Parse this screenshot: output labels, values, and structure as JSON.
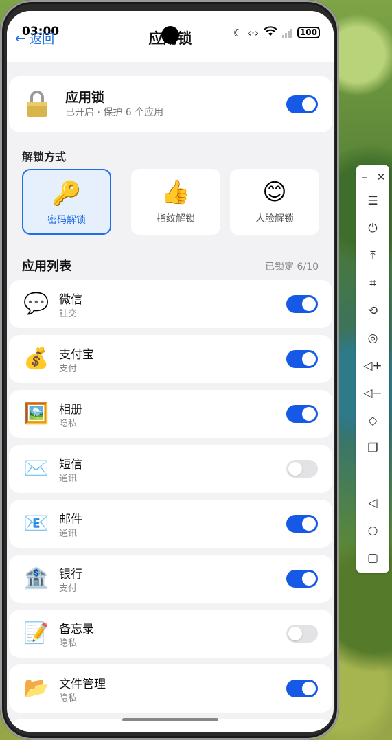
{
  "status_bar": {
    "time": "03:00",
    "battery": "100"
  },
  "nav": {
    "back_label": "返回",
    "title": "应用锁"
  },
  "app_lock": {
    "title": "应用锁",
    "subtitle": "已开启 · 保护 6 个应用",
    "enabled": true
  },
  "unlock_methods": {
    "heading": "解锁方式",
    "options": [
      {
        "emoji": "🔑",
        "label": "密码解锁",
        "selected": true
      },
      {
        "emoji": "👍",
        "label": "指纹解锁",
        "selected": false
      },
      {
        "emoji": "😊",
        "label": "人脸解锁",
        "selected": false
      }
    ]
  },
  "app_list": {
    "heading": "应用列表",
    "locked_count": "已锁定 6/10",
    "items": [
      {
        "emoji": "💬",
        "name": "微信",
        "category": "社交",
        "locked": true
      },
      {
        "emoji": "💰",
        "name": "支付宝",
        "category": "支付",
        "locked": true
      },
      {
        "emoji": "🖼️",
        "name": "相册",
        "category": "隐私",
        "locked": true
      },
      {
        "emoji": "✉️",
        "name": "短信",
        "category": "通讯",
        "locked": false
      },
      {
        "emoji": "📧",
        "name": "邮件",
        "category": "通讯",
        "locked": true
      },
      {
        "emoji": "🏦",
        "name": "银行",
        "category": "支付",
        "locked": true
      },
      {
        "emoji": "📝",
        "name": "备忘录",
        "category": "隐私",
        "locked": false
      },
      {
        "emoji": "📂",
        "name": "文件管理",
        "category": "隐私",
        "locked": true
      }
    ]
  },
  "colors": {
    "accent": "#1659e6",
    "link": "#1f6fe6"
  }
}
